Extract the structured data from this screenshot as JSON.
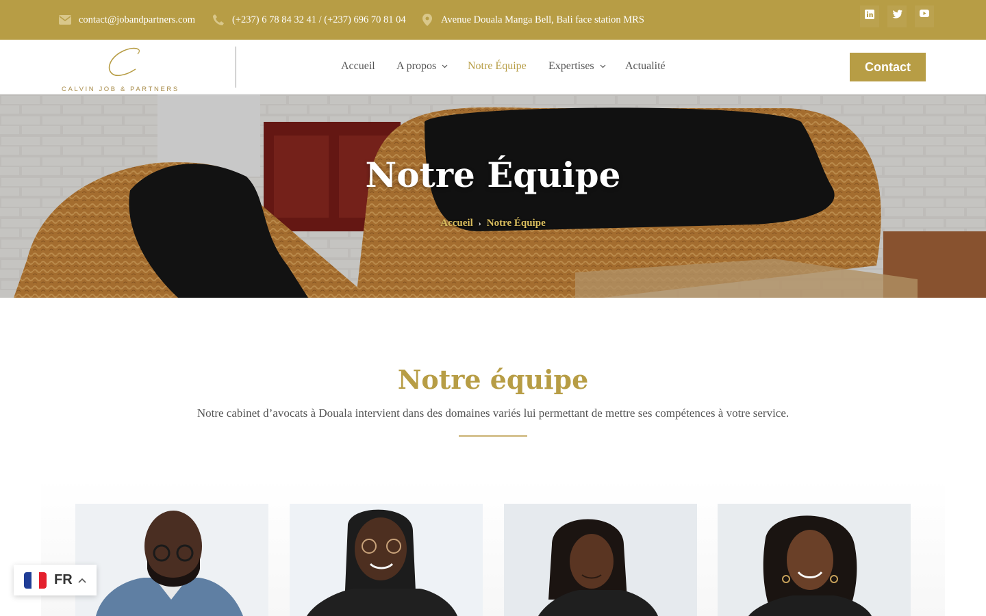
{
  "topbar": {
    "email": "contact@jobandpartners.com",
    "phone": "(+237) 6 78 84 32 41 / (+237) 696 70 81 04",
    "address": "Avenue Douala Manga Bell, Bali face station MRS",
    "icons": [
      "mail-icon",
      "phone-icon",
      "location-pin-icon",
      "linkedin-icon",
      "twitter-icon",
      "youtube-icon"
    ]
  },
  "header": {
    "logo_text": "CALVIN JOB & PARTNERS",
    "nav": [
      {
        "label": "Accueil",
        "dropdown": false
      },
      {
        "label": "A propos",
        "dropdown": true
      },
      {
        "label": "Notre Équipe",
        "dropdown": false,
        "active": true
      },
      {
        "label": "Expertises",
        "dropdown": true
      },
      {
        "label": "Actualité",
        "dropdown": false
      }
    ],
    "cta": "Contact"
  },
  "hero": {
    "title": "Notre Équipe",
    "breadcrumb": [
      "Accueil",
      "Notre Équipe"
    ]
  },
  "section": {
    "title": "Notre équipe",
    "subtitle": "Notre cabinet d’avocats à Douala intervient dans des domaines variés lui permettant de mettre ses compétences à votre service."
  },
  "language": {
    "code": "FR",
    "flag": "france-flag-icon"
  },
  "colors": {
    "gold": "#b79d45",
    "text": "#555555",
    "white": "#ffffff"
  }
}
